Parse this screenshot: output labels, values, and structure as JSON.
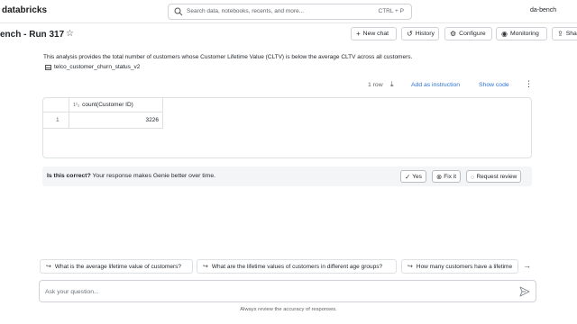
{
  "topbar": {
    "logo": "databricks",
    "search_placeholder": "Search data, notebooks, recents, and more...",
    "shortcut": "CTRL + P",
    "user": "da-bench"
  },
  "header": {
    "title": "ench - Run 317",
    "star_icon": "star-outline-icon",
    "buttons": [
      {
        "label": "New chat",
        "glyph": "+"
      },
      {
        "label": "History",
        "glyph": "↺"
      },
      {
        "label": "Configure",
        "glyph": "⚙"
      },
      {
        "label": "Monitoring",
        "glyph": "◉"
      },
      {
        "label": "Sha",
        "glyph": "⇪"
      }
    ]
  },
  "answer": {
    "text": "This analysis provides the total number of customers whose Customer Lifetime Value (CLTV) is below the average CLTV across all customers.",
    "table_name": "telco_customer_churn_status_v2",
    "row_count": "1 row",
    "add_instruction": "Add as instruction",
    "show_code": "Show code"
  },
  "result_table": {
    "column_type": "1²₃",
    "column": "count(Customer ID)",
    "rows": [
      {
        "index": "1",
        "value": "3226"
      }
    ]
  },
  "feedback": {
    "question": "Is this correct?",
    "hint": "Your response makes Genie better over time.",
    "yes": "Yes",
    "fix": "Fix it",
    "review": "Request review"
  },
  "suggestions": [
    "What is the average lifetime value of customers?",
    "What are the lifetime values of customers in different age groups?",
    "How many customers have a lifetime"
  ],
  "composer": {
    "placeholder": "Ask your question..."
  },
  "disclaimer": "Always review the accuracy of responses.",
  "colors": {
    "accent": "#2b72d3",
    "border": "#dde1e4",
    "feedback_bg": "#f4f5f6"
  }
}
